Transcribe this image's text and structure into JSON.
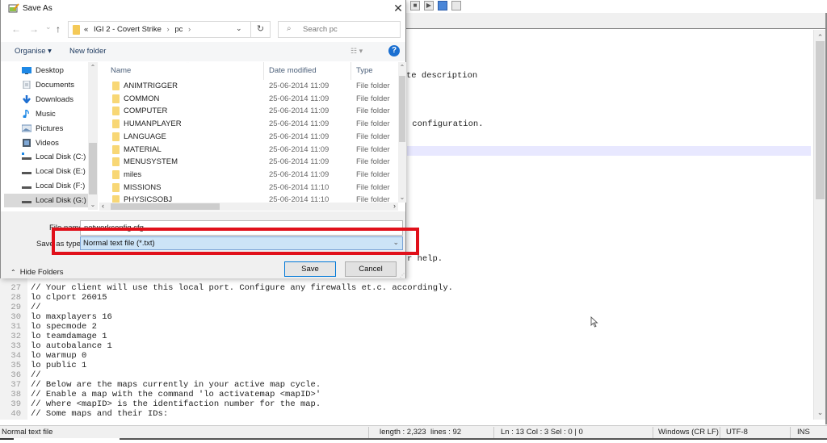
{
  "editor": {
    "toolbar_icons": [
      "stop-record-icon",
      "play-macro-icon",
      "run-macro-icon",
      "save-macro-icon"
    ],
    "visible_fragments": [
      {
        "id": "frag1",
        "text": "te description"
      },
      {
        "id": "frag2",
        "text": " configuration."
      },
      {
        "id": "frag3",
        "text": "r help."
      }
    ],
    "lines": [
      {
        "num": "27",
        "text": "// Your client will use this local port. Configure any firewalls et.c. accordingly."
      },
      {
        "num": "28",
        "text": "lo clport 26015"
      },
      {
        "num": "29",
        "text": "//"
      },
      {
        "num": "30",
        "text": "lo maxplayers 16"
      },
      {
        "num": "31",
        "text": "lo specmode 2"
      },
      {
        "num": "32",
        "text": "lo teamdamage 1"
      },
      {
        "num": "33",
        "text": "lo autobalance 1"
      },
      {
        "num": "34",
        "text": "lo warmup 0"
      },
      {
        "num": "35",
        "text": "lo public 1"
      },
      {
        "num": "36",
        "text": "//"
      },
      {
        "num": "37",
        "text": "// Below are the maps currently in your active map cycle."
      },
      {
        "num": "38",
        "text": "// Enable a map with the command 'lo activatemap <mapID>'"
      },
      {
        "num": "39",
        "text": "// where <mapID> is the identifaction number for the map."
      },
      {
        "num": "40",
        "text": "// Some maps and their IDs:"
      }
    ]
  },
  "statusbar": {
    "file_type": "Normal text file",
    "length": "length : 2,323",
    "lines": "lines : 92",
    "position": "Ln : 13   Col : 3   Sel : 0 | 0",
    "eol": "Windows (CR LF)",
    "encoding": "UTF-8",
    "mode": "INS"
  },
  "dialog": {
    "title": "Save As",
    "close_symbol": "✕",
    "nav": {
      "back": "←",
      "forward": "→",
      "recent": "⌄",
      "up": "↑"
    },
    "address": {
      "overflow": "«",
      "crumbs": [
        "IGI 2 - Covert Strike",
        "pc"
      ],
      "separator": "›"
    },
    "search_placeholder": "Search pc",
    "toolbar": {
      "organise": "Organise ▾",
      "new_folder": "New folder",
      "help": "?"
    },
    "nav_pane": [
      {
        "label": "Desktop",
        "icon": "desktop-icon",
        "color": "#1e88e5"
      },
      {
        "label": "Documents",
        "icon": "documents-icon",
        "color": "#9aa4b0"
      },
      {
        "label": "Downloads",
        "icon": "downloads-icon",
        "color": "#1e6fd1"
      },
      {
        "label": "Music",
        "icon": "music-icon",
        "color": "#1e88e5"
      },
      {
        "label": "Pictures",
        "icon": "pictures-icon",
        "color": "#6b8fb8"
      },
      {
        "label": "Videos",
        "icon": "videos-icon",
        "color": "#4a5a6a"
      },
      {
        "label": "Local Disk (C:)",
        "icon": "system-drive-icon",
        "color": "#555555"
      },
      {
        "label": "Local Disk (E:)",
        "icon": "drive-icon",
        "color": "#555555"
      },
      {
        "label": "Local Disk (F:)",
        "icon": "drive-icon",
        "color": "#555555"
      },
      {
        "label": "Local Disk (G:)",
        "icon": "drive-icon",
        "color": "#555555",
        "selected": true
      }
    ],
    "columns": {
      "name": "Name",
      "date": "Date modified",
      "type": "Type"
    },
    "files": [
      {
        "name": "ANIMTRIGGER",
        "date": "25-06-2014 11:09",
        "type": "File folder"
      },
      {
        "name": "COMMON",
        "date": "25-06-2014 11:09",
        "type": "File folder"
      },
      {
        "name": "COMPUTER",
        "date": "25-06-2014 11:09",
        "type": "File folder"
      },
      {
        "name": "HUMANPLAYER",
        "date": "25-06-2014 11:09",
        "type": "File folder"
      },
      {
        "name": "LANGUAGE",
        "date": "25-06-2014 11:09",
        "type": "File folder"
      },
      {
        "name": "MATERIAL",
        "date": "25-06-2014 11:09",
        "type": "File folder"
      },
      {
        "name": "MENUSYSTEM",
        "date": "25-06-2014 11:09",
        "type": "File folder"
      },
      {
        "name": "miles",
        "date": "25-06-2014 11:09",
        "type": "File folder"
      },
      {
        "name": "MISSIONS",
        "date": "25-06-2014 11:10",
        "type": "File folder"
      },
      {
        "name": "PHYSICSOBJ",
        "date": "25-06-2014 11:10",
        "type": "File folder"
      }
    ],
    "file_name_label": "File name:",
    "file_name_value": "networkconfig.cfg",
    "save_type_label": "Save as type:",
    "save_type_value": "Normal text file (*.txt)",
    "hide_folders": "Hide Folders",
    "save_button": "Save",
    "cancel_button": "Cancel"
  },
  "annotation": {
    "highlight_color": "#e0101a"
  }
}
